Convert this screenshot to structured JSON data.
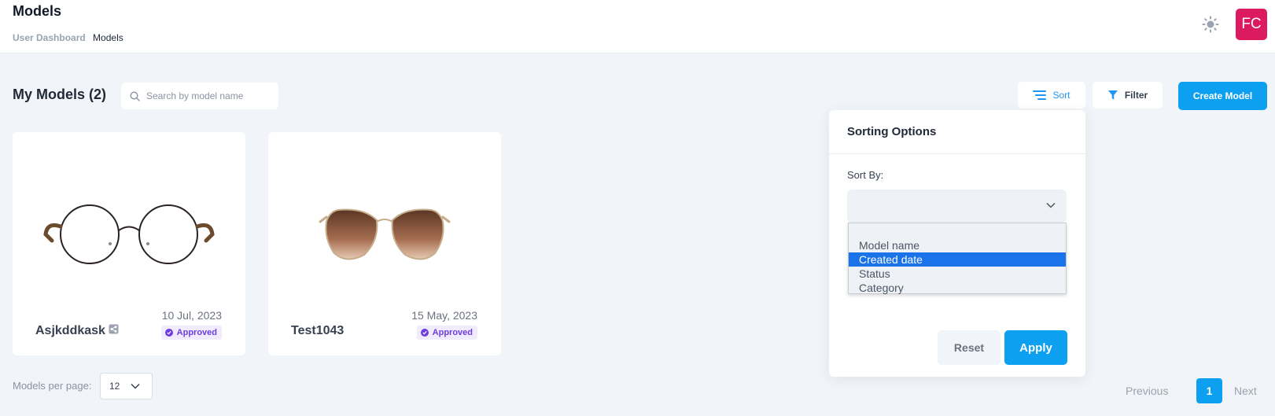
{
  "header": {
    "title": "Models",
    "breadcrumb": {
      "parent": "User Dashboard",
      "current": "Models"
    },
    "theme_icon": "sun-icon",
    "avatar_initials": "FC",
    "avatar_color": "#dc1a5f"
  },
  "toolbar": {
    "heading": "My Models (2)",
    "search_placeholder": "Search by model name",
    "sort_label": "Sort",
    "filter_label": "Filter",
    "create_label": "Create Model"
  },
  "models": [
    {
      "name": "Asjkddkask",
      "date": "10 Jul, 2023",
      "status": "Approved",
      "shared": true,
      "image": "eyeglasses-round-thin"
    },
    {
      "name": "Test1043",
      "date": "15 May, 2023",
      "status": "Approved",
      "shared": false,
      "image": "sunglasses-gradient-brown"
    }
  ],
  "pagination": {
    "per_page_label": "Models per page:",
    "per_page_value": "12",
    "previous_label": "Previous",
    "current_page": "1",
    "next_label": "Next"
  },
  "sort_panel": {
    "title": "Sorting Options",
    "sort_by_label": "Sort By:",
    "options": [
      "Model name",
      "Created date",
      "Status",
      "Category"
    ],
    "highlighted_option": "Created date",
    "reset_label": "Reset",
    "apply_label": "Apply"
  },
  "colors": {
    "accent": "#0da0f0",
    "approved_text": "#6d3ce0",
    "approved_bg": "#f1ecfd",
    "page_bg": "#f1f4f8"
  }
}
